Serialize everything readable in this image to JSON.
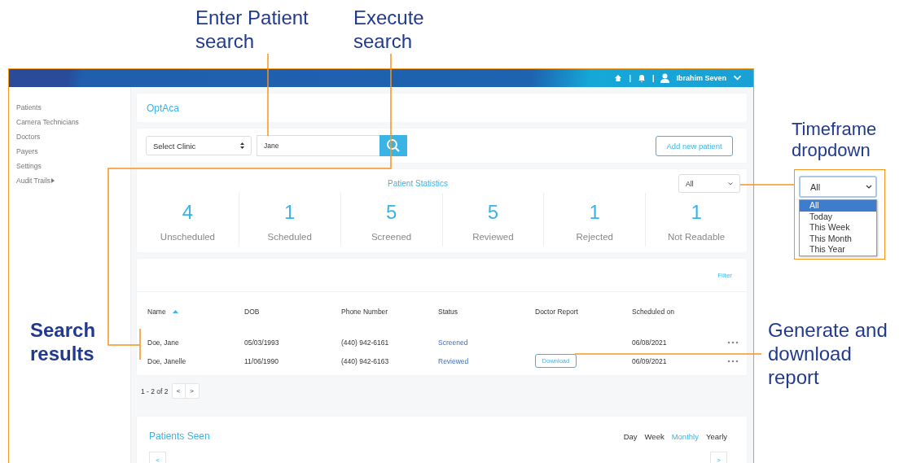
{
  "callouts": [
    {
      "text": "Enter Patient search"
    },
    {
      "text": "Execute search"
    },
    {
      "text": "Timeframe dropdown"
    },
    {
      "text": "Search results"
    },
    {
      "text": "Generate and download report"
    }
  ],
  "header": {
    "separators": [
      "|",
      "|"
    ],
    "user": "Ibrahim Seven"
  },
  "sidebar": {
    "items": [
      {
        "label": "Patients",
        "kind": "link"
      },
      {
        "label": "Camera Technicians",
        "kind": "link"
      },
      {
        "label": "Doctors",
        "kind": "link"
      },
      {
        "label": "Payers",
        "kind": "link"
      },
      {
        "label": "Settings",
        "kind": "link"
      },
      {
        "label": "Audit Trails",
        "kind": "submenu"
      }
    ]
  },
  "brand": "OptAca",
  "search": {
    "clinic_select": "Select Clinic",
    "value": "Jane",
    "add_button": "Add new patient"
  },
  "statistics": {
    "title": "Patient Statistics",
    "timeframe": "All",
    "stats": [
      {
        "value": "4",
        "label": "Unscheduled"
      },
      {
        "value": "1",
        "label": "Scheduled"
      },
      {
        "value": "5",
        "label": "Screened"
      },
      {
        "value": "5",
        "label": "Reviewed"
      },
      {
        "value": "1",
        "label": "Rejected"
      },
      {
        "value": "1",
        "label": "Not Readable"
      }
    ]
  },
  "table": {
    "filter": "Filter",
    "columns": [
      {
        "label": "Name",
        "sorted": true
      },
      {
        "label": "DOB",
        "sorted": false
      },
      {
        "label": "Phone Number",
        "sorted": false
      },
      {
        "label": "Status",
        "sorted": false
      },
      {
        "label": "Doctor Report",
        "sorted": false
      },
      {
        "label": "Scheduled on",
        "sorted": false
      }
    ],
    "rows": [
      {
        "name": "Doe, Jane",
        "dob": "05/03/1993",
        "phone": "(440) 942-6161",
        "status": "Screened",
        "scheduled": "06/08/2021"
      },
      {
        "name": "Doe, Janelle",
        "dob": "11/06/1990",
        "phone": "(440) 942-6163",
        "status": "Reviewed",
        "report": "Download",
        "scheduled": "06/09/2021"
      }
    ]
  },
  "pagination": {
    "range": "1 - 2 of 2",
    "prev": "<",
    "next": ">"
  },
  "patients_seen": {
    "title": "Patients Seen",
    "periods": [
      {
        "label": "Day",
        "selected": false
      },
      {
        "label": "Week",
        "selected": false
      },
      {
        "label": "Monthly",
        "selected": true
      },
      {
        "label": "Yearly",
        "selected": false
      }
    ],
    "prev": "<",
    "next": ">"
  },
  "timeframe_dropdown": {
    "value": "All",
    "options": [
      {
        "label": "All",
        "selected": true
      },
      {
        "label": "Today",
        "selected": false
      },
      {
        "label": "This Week",
        "selected": false
      },
      {
        "label": "This Month",
        "selected": false
      },
      {
        "label": "This Year",
        "selected": false
      }
    ]
  }
}
